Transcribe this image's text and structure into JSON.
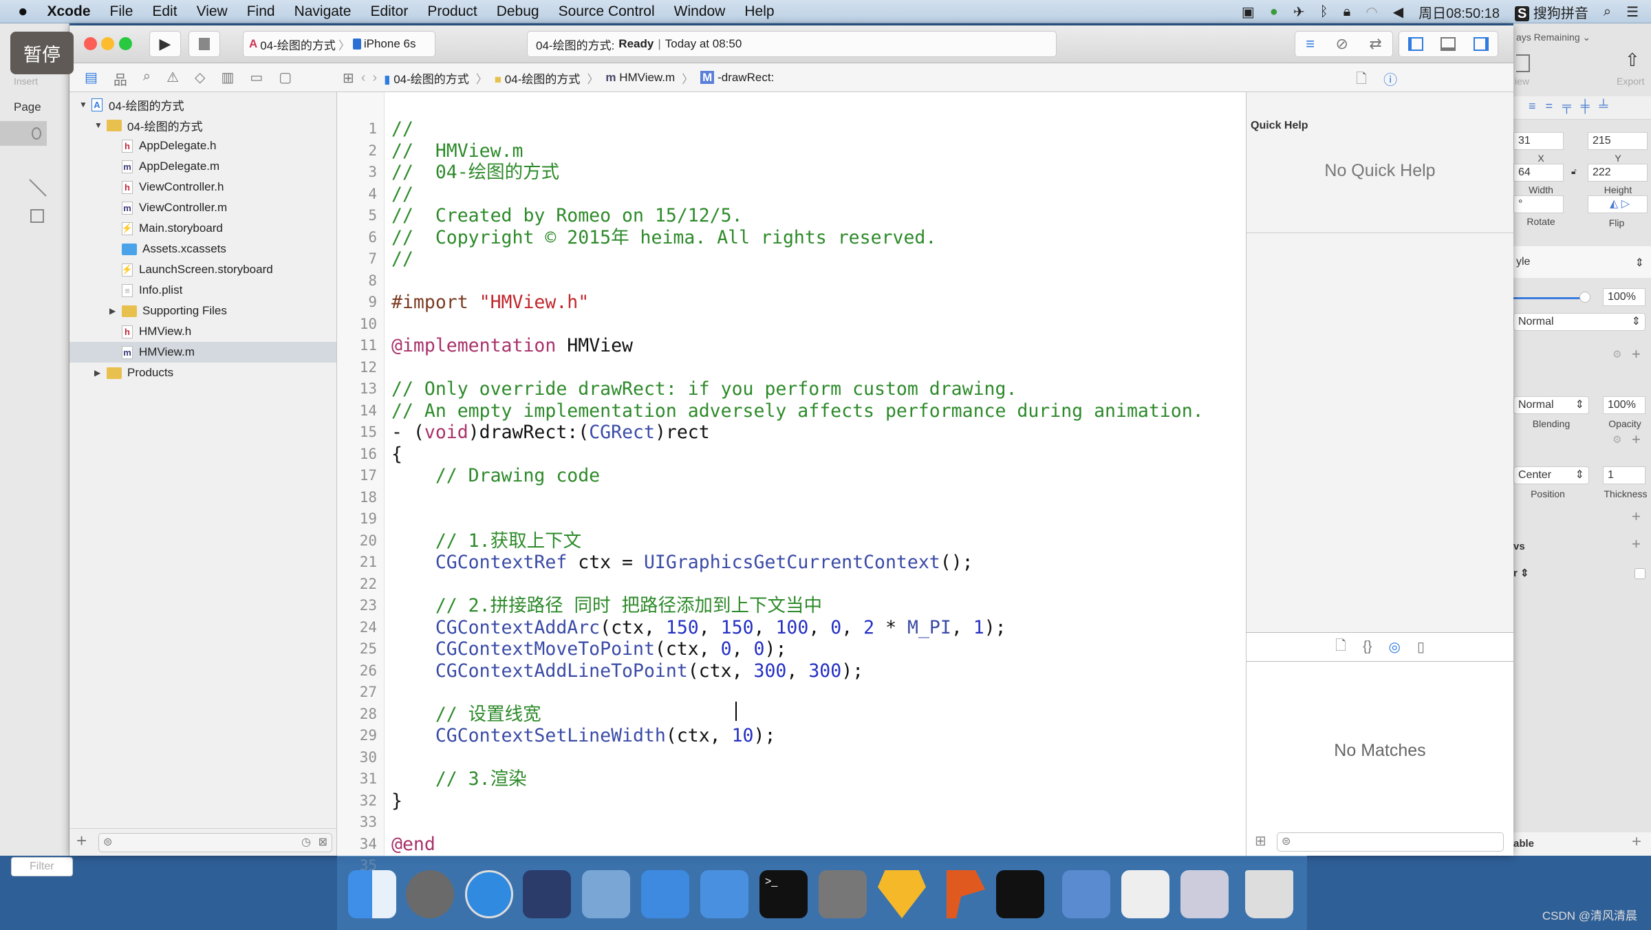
{
  "menubar": {
    "apple": "",
    "app": "Xcode",
    "items": [
      "File",
      "Edit",
      "View",
      "Find",
      "Navigate",
      "Editor",
      "Product",
      "Debug",
      "Source Control",
      "Window",
      "Help"
    ],
    "clock": "周日08:50:18",
    "ime": "搜狗拼音"
  },
  "overlay": {
    "pause": "暂停"
  },
  "sketch_left": {
    "insert": "Insert",
    "page": "Page",
    "filter_placeholder": "Filter"
  },
  "sketch_right": {
    "days_remaining": "ays Remaining",
    "view": "iew",
    "export": "Export",
    "x": "31",
    "x_label": "X",
    "y": "215",
    "y_label": "Y",
    "width": "64",
    "width_label": "Width",
    "height": "222",
    "height_label": "Height",
    "rotate": "°",
    "rotate_label": "Rotate",
    "flip_label": "Flip",
    "style": "yle",
    "opacity_slider": 1.0,
    "opacity_value": "100%",
    "blend": "Normal",
    "fill_blend": "Normal",
    "fill_opacity": "100%",
    "blending_label": "Blending",
    "opacity_label": "Opacity",
    "position": "Center",
    "thickness": "1",
    "position_label": "Position",
    "thickness_label": "Thickness",
    "shadows": "vs",
    "resizing": "r",
    "bottom_label": "able"
  },
  "toolbar": {
    "scheme": "04-绘图的方式",
    "device": "iPhone 6s",
    "status_project": "04-绘图的方式:",
    "status_state": "Ready",
    "status_time": "Today at 08:50"
  },
  "jumpbar": {
    "items": [
      "04-绘图的方式",
      "04-绘图的方式",
      "HMView.m",
      "-drawRect:"
    ]
  },
  "navigator": {
    "rows": [
      {
        "label": "04-绘图的方式",
        "level": 0,
        "type": "project",
        "disclosure": "open"
      },
      {
        "label": "04-绘图的方式",
        "level": 1,
        "type": "folder",
        "disclosure": "open"
      },
      {
        "label": "AppDelegate.h",
        "level": 2,
        "type": "h"
      },
      {
        "label": "AppDelegate.m",
        "level": 2,
        "type": "m"
      },
      {
        "label": "ViewController.h",
        "level": 2,
        "type": "h"
      },
      {
        "label": "ViewController.m",
        "level": 2,
        "type": "m"
      },
      {
        "label": "Main.storyboard",
        "level": 2,
        "type": "sb"
      },
      {
        "label": "Assets.xcassets",
        "level": 2,
        "type": "assets"
      },
      {
        "label": "LaunchScreen.storyboard",
        "level": 2,
        "type": "sb"
      },
      {
        "label": "Info.plist",
        "level": 2,
        "type": "plist"
      },
      {
        "label": "Supporting Files",
        "level": 2,
        "type": "folder",
        "disclosure": "closed"
      },
      {
        "label": "HMView.h",
        "level": 2,
        "type": "h"
      },
      {
        "label": "HMView.m",
        "level": 2,
        "type": "m",
        "selected": true
      },
      {
        "label": "Products",
        "level": 1,
        "type": "folder",
        "disclosure": "closed"
      }
    ]
  },
  "editor": {
    "lines": [
      [
        [
          "c",
          "//"
        ]
      ],
      [
        [
          "c",
          "//  HMView.m"
        ]
      ],
      [
        [
          "c",
          "//  04-绘图的方式"
        ]
      ],
      [
        [
          "c",
          "//"
        ]
      ],
      [
        [
          "c",
          "//  Created by Romeo on 15/12/5."
        ]
      ],
      [
        [
          "c",
          "//  Copyright © 2015年 heima. All rights reserved."
        ]
      ],
      [
        [
          "c",
          "//"
        ]
      ],
      [],
      [
        [
          "p",
          "#import "
        ],
        [
          "s",
          "\"HMView.h\""
        ]
      ],
      [],
      [
        [
          "k",
          "@implementation"
        ],
        [
          "x",
          " HMView"
        ]
      ],
      [],
      [
        [
          "c",
          "// Only override drawRect: if you perform custom drawing."
        ]
      ],
      [
        [
          "c",
          "// An empty implementation adversely affects performance during animation."
        ]
      ],
      [
        [
          "x",
          "- ("
        ],
        [
          "k",
          "void"
        ],
        [
          "x",
          ")drawRect:("
        ],
        [
          "f",
          "CGRect"
        ],
        [
          "x",
          ")rect"
        ]
      ],
      [
        [
          "x",
          "{"
        ]
      ],
      [
        [
          "c",
          "    // Drawing code"
        ]
      ],
      [],
      [],
      [
        [
          "c",
          "    // 1.获取上下文"
        ]
      ],
      [
        [
          "f",
          "    CGContextRef"
        ],
        [
          "x",
          " ctx = "
        ],
        [
          "f",
          "UIGraphicsGetCurrentContext"
        ],
        [
          "x",
          "();"
        ]
      ],
      [],
      [
        [
          "c",
          "    // 2.拼接路径 同时 把路径添加到上下文当中"
        ]
      ],
      [
        [
          "f",
          "    CGContextAddArc"
        ],
        [
          "x",
          "(ctx, "
        ],
        [
          "n",
          "150"
        ],
        [
          "x",
          ", "
        ],
        [
          "n",
          "150"
        ],
        [
          "x",
          ", "
        ],
        [
          "n",
          "100"
        ],
        [
          "x",
          ", "
        ],
        [
          "n",
          "0"
        ],
        [
          "x",
          ", "
        ],
        [
          "n",
          "2"
        ],
        [
          "x",
          " * "
        ],
        [
          "f",
          "M_PI"
        ],
        [
          "x",
          ", "
        ],
        [
          "n",
          "1"
        ],
        [
          "x",
          ");"
        ]
      ],
      [
        [
          "f",
          "    CGContextMoveToPoint"
        ],
        [
          "x",
          "(ctx, "
        ],
        [
          "n",
          "0"
        ],
        [
          "x",
          ", "
        ],
        [
          "n",
          "0"
        ],
        [
          "x",
          ");"
        ]
      ],
      [
        [
          "f",
          "    CGContextAddLineToPoint"
        ],
        [
          "x",
          "(ctx, "
        ],
        [
          "n",
          "300"
        ],
        [
          "x",
          ", "
        ],
        [
          "n",
          "300"
        ],
        [
          "x",
          ");"
        ]
      ],
      [],
      [
        [
          "c",
          "    // 设置线宽"
        ]
      ],
      [
        [
          "f",
          "    CGContextSetLineWidth"
        ],
        [
          "x",
          "(ctx, "
        ],
        [
          "n",
          "10"
        ],
        [
          "x",
          ");"
        ]
      ],
      [],
      [
        [
          "c",
          "    // 3.渲染"
        ]
      ],
      [
        [
          "x",
          "}"
        ]
      ],
      [],
      [
        [
          "k",
          "@end"
        ]
      ],
      []
    ]
  },
  "utility": {
    "quick_help_title": "Quick Help",
    "quick_help_empty": "No Quick Help",
    "library_empty": "No Matches"
  },
  "watermark": "CSDN @清风清晨",
  "colors": {
    "comment": "#2d8a2a",
    "keyword": "#a8326a",
    "number": "#2430c4",
    "type": "#3a4aa6",
    "accent": "#2f7be0"
  }
}
